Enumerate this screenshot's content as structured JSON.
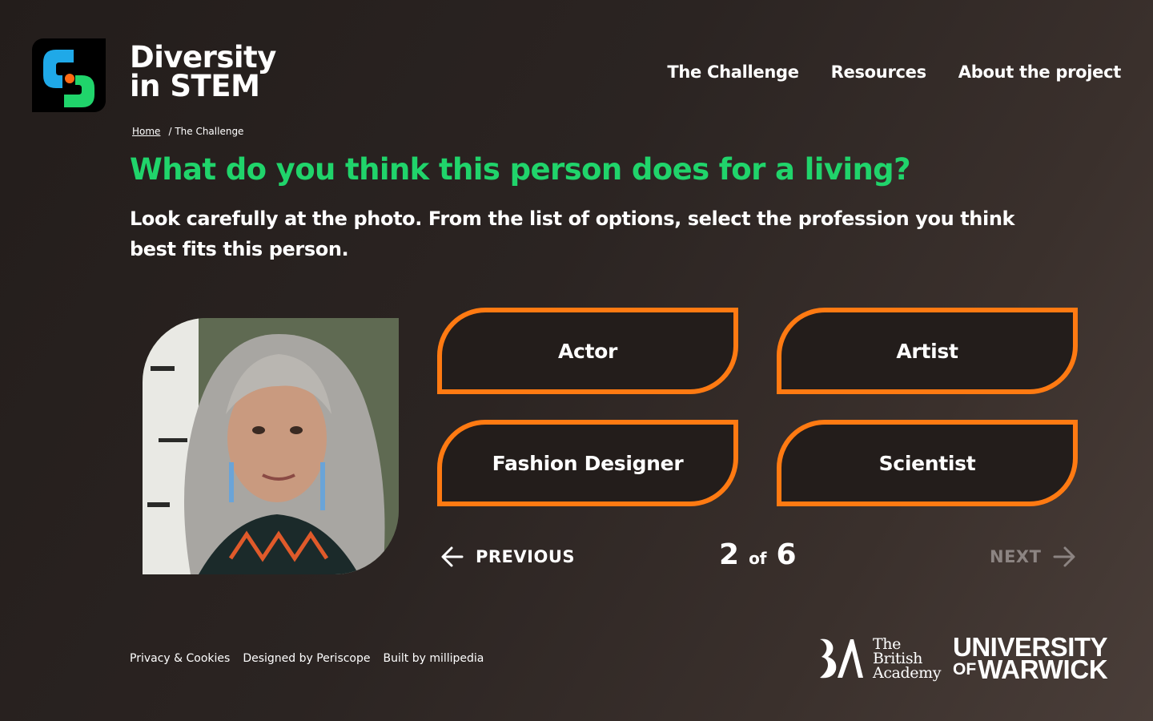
{
  "brand": {
    "name_line1": "Diversity",
    "name_line2": "in STEM",
    "colors": {
      "blue": "#1fa9e8",
      "green": "#20d46b",
      "orange": "#ff6a13"
    }
  },
  "nav": {
    "items": [
      "The Challenge",
      "Resources",
      "About the project"
    ]
  },
  "breadcrumb": {
    "home": "Home",
    "separator": "/",
    "current": "The Challenge"
  },
  "question": {
    "title": "What do you think this person does for a living?",
    "instructions": "Look carefully at the photo. From the list of options, select the profession you think best fits this person."
  },
  "options": [
    "Actor",
    "Artist",
    "Fashion Designer",
    "Scientist"
  ],
  "pager": {
    "previous": "PREVIOUS",
    "next": "NEXT",
    "current": "2",
    "of": "of",
    "total": "6"
  },
  "footer": {
    "links": [
      "Privacy & Cookies",
      "Designed by Periscope",
      "Built by millipedia"
    ],
    "british_academy": [
      "The",
      "British",
      "Academy"
    ],
    "warwick_line1": "UNIVERSITY",
    "warwick_of": "OF",
    "warwick_line2": "WARWICK"
  },
  "colors": {
    "accent_green": "#20d46b",
    "option_border": "#ff7a12",
    "background": "#2b2422",
    "disabled_text": "#8c8482"
  }
}
